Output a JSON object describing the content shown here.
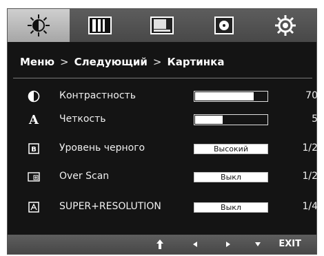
{
  "tabs": [
    {
      "name": "brightness-icon",
      "active": true
    },
    {
      "name": "color-bars-icon",
      "active": false
    },
    {
      "name": "picture-position-icon",
      "active": false
    },
    {
      "name": "disc-icon",
      "active": false
    },
    {
      "name": "settings-gear-icon",
      "active": false
    }
  ],
  "breadcrumb": {
    "menu": "Меню",
    "sep1": ">",
    "next": "Следующий",
    "sep2": ">",
    "current": "Картинка"
  },
  "rows": [
    {
      "icon": "contrast-icon",
      "icon_glyph": "◑",
      "label": "Контрастность",
      "control": "bar",
      "level_percent": 82,
      "value": "70"
    },
    {
      "icon": "sharpness-icon",
      "icon_glyph": "A",
      "label": "Четкость",
      "control": "bar",
      "level_percent": 38,
      "value": "5"
    },
    {
      "icon": "black-level-icon",
      "icon_glyph": "B",
      "label": "Уровень черного",
      "control": "option",
      "option": "Высокий",
      "value": "1/2"
    },
    {
      "icon": "over-scan-icon",
      "icon_glyph": "⊞",
      "label": "Over Scan",
      "control": "option",
      "option": "Выкл",
      "value": "1/2"
    },
    {
      "icon": "super-resolution-icon",
      "icon_glyph": "⊠",
      "label": "SUPER+RESOLUTION",
      "control": "option",
      "option": "Выкл",
      "value": "1/4"
    }
  ],
  "bottom": {
    "up": "↑",
    "left": "◂",
    "right": "▸",
    "down": "▾",
    "exit": "EXIT"
  },
  "colors": {
    "background": "#141414",
    "tab_active": "#bdbdbd",
    "bar_fill": "#ffffff"
  }
}
